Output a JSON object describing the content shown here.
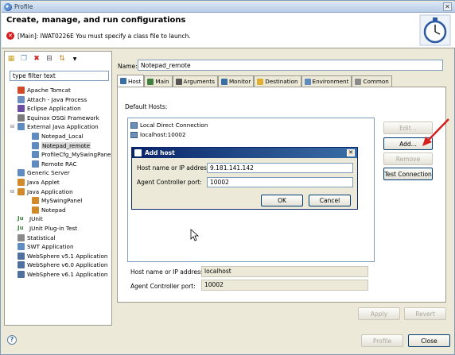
{
  "window": {
    "title": "Profile",
    "close_glyph": "✕"
  },
  "header": {
    "title": "Create, manage, and run configurations",
    "error_message": "[Main]: IWAT0226E You must specify a class file to launch.",
    "error_icon": "error-icon"
  },
  "left": {
    "filter_value": "type filter text",
    "tree": [
      {
        "label": "Apache Tomcat",
        "level": 0,
        "color": "#d04a2a"
      },
      {
        "label": "Attach - Java Process",
        "level": 0,
        "color": "#6a8fbf"
      },
      {
        "label": "Eclipse Application",
        "level": 0,
        "color": "#6b4da0"
      },
      {
        "label": "Equinox OSGi Framework",
        "level": 0,
        "color": "#7a7a7a"
      },
      {
        "label": "External Java Application",
        "level": 0,
        "color": "#5f8cc0",
        "expanded": true
      },
      {
        "label": "Notepad_Local",
        "level": 1,
        "color": "#5f8cc0"
      },
      {
        "label": "Notepad_remote",
        "level": 1,
        "color": "#5f8cc0",
        "selected": true
      },
      {
        "label": "ProfileCfg_MySwingPane",
        "level": 1,
        "color": "#5f8cc0"
      },
      {
        "label": "Remote RAC",
        "level": 1,
        "color": "#5f8cc0"
      },
      {
        "label": "Generic Server",
        "level": 0,
        "color": "#5f8cc0"
      },
      {
        "label": "Java Applet",
        "level": 0,
        "color": "#d08a2a"
      },
      {
        "label": "Java Application",
        "level": 0,
        "color": "#d08a2a",
        "expanded": true
      },
      {
        "label": "MySwingPanel",
        "level": 1,
        "color": "#d08a2a"
      },
      {
        "label": "Notepad",
        "level": 1,
        "color": "#d08a2a"
      },
      {
        "label": "JUnit",
        "level": 0,
        "color": "#3f7f3f",
        "prefix": "Ju"
      },
      {
        "label": "JUnit Plug-in Test",
        "level": 0,
        "color": "#3f7f3f",
        "prefix": "Ju"
      },
      {
        "label": "Statistical",
        "level": 0,
        "color": "#8a8a8a"
      },
      {
        "label": "SWT Application",
        "level": 0,
        "color": "#5f8cc0"
      },
      {
        "label": "WebSphere v5.1 Application",
        "level": 0,
        "color": "#4f6f9f"
      },
      {
        "label": "WebSphere v6.0 Application",
        "level": 0,
        "color": "#4f6f9f"
      },
      {
        "label": "WebSphere v6.1 Application",
        "level": 0,
        "color": "#4f6f9f"
      }
    ]
  },
  "main": {
    "name_label": "Name:",
    "name_value": "Notepad_remote",
    "tabs": [
      {
        "label": "Host",
        "color": "#3a6ea5",
        "active": true
      },
      {
        "label": "Main",
        "color": "#3f7f3f"
      },
      {
        "label": "Arguments",
        "color": "#555555"
      },
      {
        "label": "Monitor",
        "color": "#3a6ea5"
      },
      {
        "label": "Destination",
        "color": "#e0b030"
      },
      {
        "label": "Environment",
        "color": "#5f8cc0"
      },
      {
        "label": "Common",
        "color": "#8a8a8a"
      }
    ],
    "default_hosts_label": "Default Hosts:",
    "hosts": [
      "Local Direct Connection",
      "localhost:10002"
    ],
    "buttons": {
      "edit": "Edit...",
      "add": "Add...",
      "remove": "Remove",
      "test": "Test Connection"
    },
    "host_ip_label": "Host name or IP address:",
    "host_ip_value": "localhost",
    "agent_port_label": "Agent Controller port:",
    "agent_port_value": "10002",
    "apply": "Apply",
    "revert": "Revert"
  },
  "dialog": {
    "title": "Add host",
    "host_label": "Host name or IP address:",
    "host_value": "9.181.141.142",
    "port_label": "Agent Controller port:",
    "port_value": "10002",
    "ok": "OK",
    "cancel": "Cancel",
    "close_glyph": "✕"
  },
  "footer": {
    "help_glyph": "?",
    "profile": "Profile",
    "close": "Close"
  },
  "colors": {
    "accent_arrow": "#d81f1f",
    "dialog_title": "#0a246a"
  }
}
